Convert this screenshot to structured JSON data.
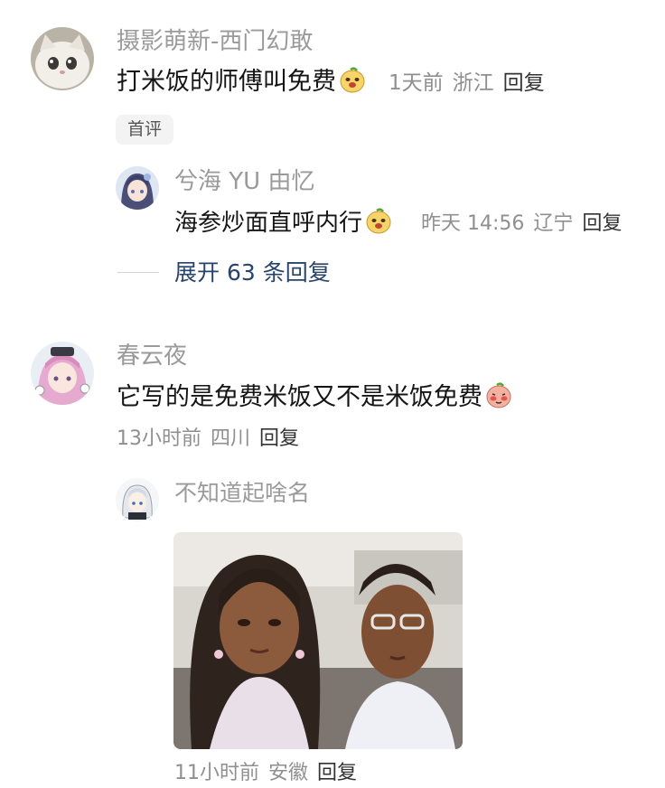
{
  "comments": [
    {
      "username": "摄影萌新-西门幻敢",
      "text": "打米饭的师傅叫免费",
      "emoji": "doge-face-icon",
      "time": "1天前",
      "location": "浙江",
      "reply_label": "回复",
      "badge": "首评"
    },
    {
      "username": "兮海 YU 由忆",
      "text": "海参炒面直呼内行",
      "emoji": "doge-face-icon",
      "time": "昨天 14:56",
      "location": "辽宁",
      "reply_label": "回复"
    },
    {
      "username": "春云夜",
      "text": "它写的是免费米饭又不是米饭免费",
      "emoji": "shy-face-icon",
      "time": "13小时前",
      "location": "四川",
      "reply_label": "回复"
    },
    {
      "username": "不知道起啥名",
      "image": "two-people-meme-photo",
      "time": "11小时前",
      "location": "安徽",
      "reply_label": "回复"
    }
  ],
  "expand": {
    "label": "展开 63 条回复"
  },
  "colors": {
    "username": "#9a9a9a",
    "meta": "#8f8f8f",
    "expand_link": "#27446b",
    "badge_bg": "#f3f3f3"
  }
}
